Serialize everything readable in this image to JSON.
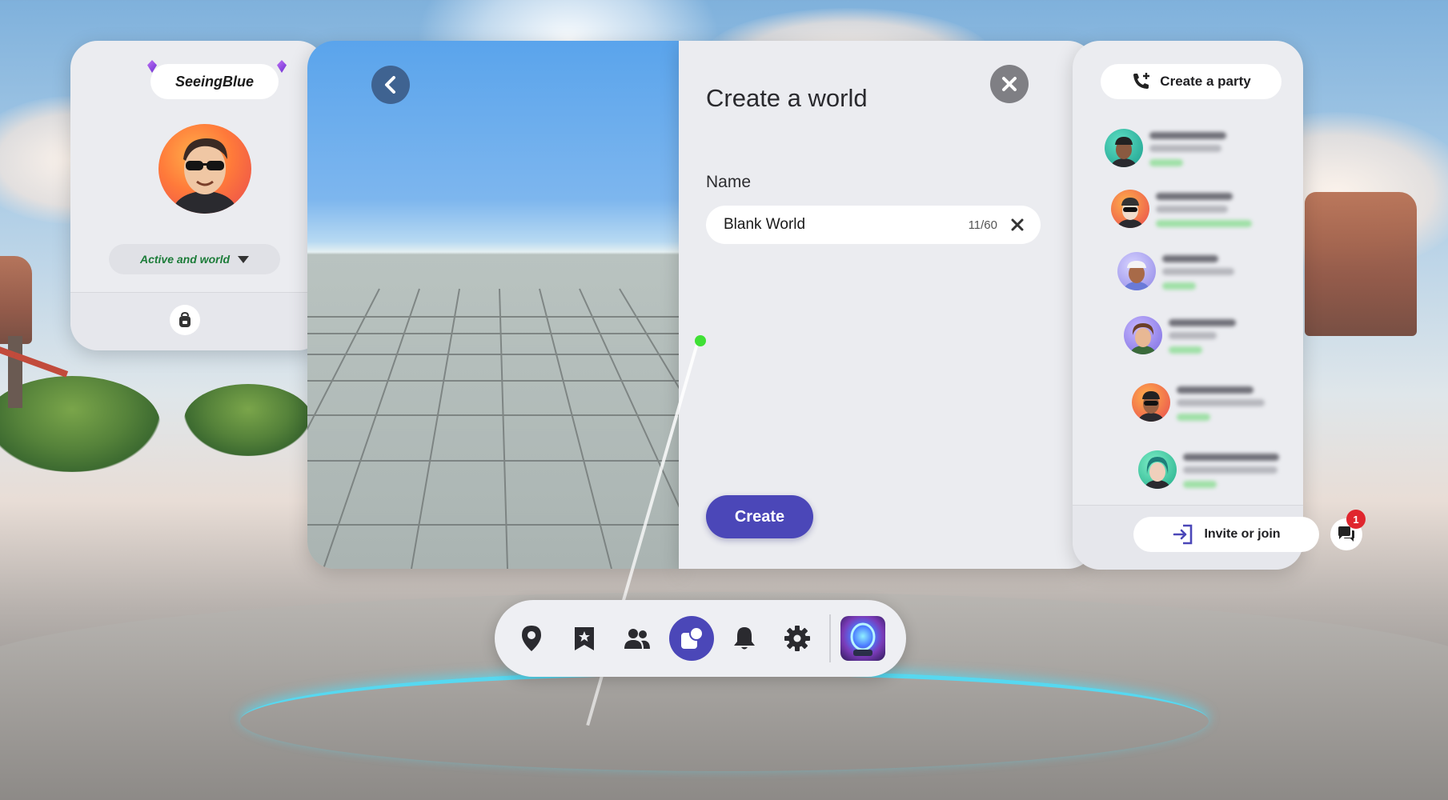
{
  "profile": {
    "username": "SeeingBlue",
    "status_label": "Active and world"
  },
  "create_world": {
    "title": "Create a world",
    "name_label": "Name",
    "name_value": "Blank World",
    "char_count": "11/60",
    "create_label": "Create"
  },
  "people": {
    "create_party_label": "Create a party",
    "invite_label": "Invite or join",
    "chat_badge": "1"
  },
  "dock": {
    "items": [
      "location-icon",
      "saved-worlds-icon",
      "people-icon",
      "create-icon",
      "notifications-icon",
      "settings-icon",
      "app-thumbnail"
    ],
    "active": "create-icon"
  },
  "colors": {
    "accent": "#4b47b8",
    "status_green": "#1c7c39",
    "back_button": "#3f6391",
    "badge": "#e0262e"
  }
}
